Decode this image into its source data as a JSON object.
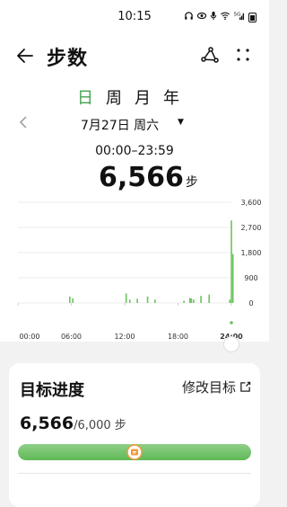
{
  "status_bar": {
    "time": "10:15",
    "icons": [
      "headphones-icon",
      "eye-icon",
      "mic-icon",
      "wifi-icon",
      "signal-5g-icon",
      "battery-icon"
    ],
    "network_label": "5G"
  },
  "app_bar": {
    "title": "步数",
    "back_icon": "arrow-left-icon",
    "share_icon": "share-icon",
    "more_icon": "more-dots-icon"
  },
  "period_tabs": [
    {
      "label": "日",
      "active": true
    },
    {
      "label": "周",
      "active": false
    },
    {
      "label": "月",
      "active": false
    },
    {
      "label": "年",
      "active": false
    }
  ],
  "date_selector": {
    "date": "7月27日 周六",
    "prev_icon": "chevron-left-icon",
    "caret_icon": "caret-down-icon"
  },
  "summary": {
    "time_range": "00:00–23:59",
    "steps": "6,566",
    "unit": "步"
  },
  "chart_data": {
    "type": "bar",
    "x_ticks": [
      "00:00",
      "06:00",
      "12:00",
      "18:00",
      "24:00"
    ],
    "y_ticks": [
      "3,600",
      "2,700",
      "1,800",
      "900",
      "0"
    ],
    "ylim": [
      0,
      3600
    ],
    "xlim": [
      0,
      24
    ],
    "grid": true,
    "color": "#6cc35f",
    "bars": [
      {
        "hour": 5.83,
        "value": 230
      },
      {
        "hour": 6.17,
        "value": 160
      },
      {
        "hour": 12.17,
        "value": 340
      },
      {
        "hour": 12.58,
        "value": 120
      },
      {
        "hour": 13.42,
        "value": 150
      },
      {
        "hour": 14.58,
        "value": 230
      },
      {
        "hour": 15.42,
        "value": 120
      },
      {
        "hour": 18.67,
        "value": 80
      },
      {
        "hour": 19.33,
        "value": 180
      },
      {
        "hour": 19.5,
        "value": 160
      },
      {
        "hour": 19.75,
        "value": 120
      },
      {
        "hour": 20.58,
        "value": 250
      },
      {
        "hour": 21.5,
        "value": 300
      },
      {
        "hour": 23.83,
        "value": 120
      },
      {
        "hour": 24.0,
        "value": 2950
      },
      {
        "hour": 24.17,
        "value": 1750
      }
    ]
  },
  "goal_card": {
    "title": "目标进度",
    "edit_label": "修改目标",
    "edit_icon": "external-edit-icon",
    "current": "6,566",
    "goal": "/6,000",
    "unit": "步",
    "progress_fraction": 1.0,
    "marker_fraction": 0.5,
    "marker_icon": "goal-flag-icon"
  },
  "colors": {
    "accent": "#3fa34d",
    "bar": "#6cc35f",
    "marker": "#f39a3a"
  }
}
